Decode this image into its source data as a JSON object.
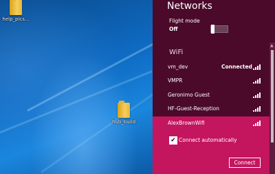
{
  "desktop": {
    "icons": [
      {
        "label": "help_pics..."
      },
      {
        "label": "hub_build"
      }
    ]
  },
  "panel": {
    "title": "Networks",
    "flight_mode": {
      "label": "Flight mode",
      "state": "Off"
    },
    "wifi_header": "WiFi",
    "networks": [
      {
        "name": "vm_dev",
        "status": "Connected"
      },
      {
        "name": "VMPR",
        "status": ""
      },
      {
        "name": "Geronimo Guest",
        "status": ""
      },
      {
        "name": "HF-Guest-Reception",
        "status": ""
      },
      {
        "name": "AlexBrownWifi",
        "status": ""
      }
    ],
    "selected": {
      "connect_automatically_label": "Connect automatically",
      "connect_automatically_checked": true,
      "connect_button": "Connect"
    }
  },
  "colors": {
    "panel_bg": "#4b0a2a",
    "selected_bg": "#c4155f",
    "desktop_blue": "#0f6cc4"
  },
  "icons": {
    "check": "✔",
    "scroll_up": "▲"
  }
}
